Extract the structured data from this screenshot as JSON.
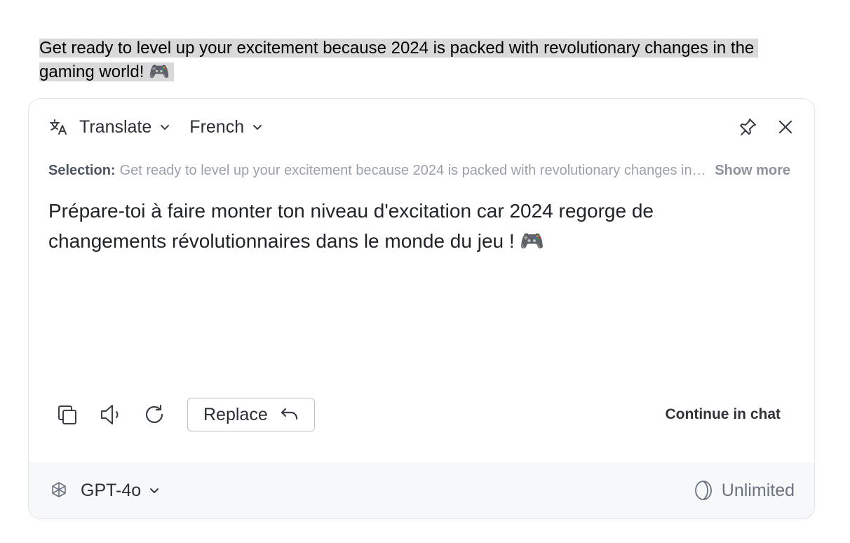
{
  "selected_text": "Get ready to level up your excitement because 2024 is packed with revolutionary changes in the gaming world! 🎮",
  "header": {
    "mode_label": "Translate",
    "language_label": "French"
  },
  "selection": {
    "label": "Selection:",
    "value": "Get ready to level up your excitement because 2024 is packed with revolutionary changes in the gaming world! 🎮",
    "show_more_label": "Show more"
  },
  "translation": "Prépare-toi à faire monter ton niveau d'excitation car 2024 regorge de changements révolutionnaires dans le monde du jeu ! 🎮",
  "actions": {
    "replace_label": "Replace",
    "continue_label": "Continue in chat"
  },
  "footer": {
    "model_label": "GPT-4o",
    "quota_label": "Unlimited"
  },
  "icons": {
    "translate": "translate-icon",
    "chevron": "chevron-down-icon",
    "pin": "pin-icon",
    "close": "close-icon",
    "copy": "copy-icon",
    "speaker": "speaker-icon",
    "regenerate": "refresh-icon",
    "undo": "undo-icon",
    "model": "openai-icon",
    "quota": "quota-icon"
  },
  "colors": {
    "highlight": "#d9d9d9",
    "footer_bg": "#f7f8fa",
    "muted_text": "#9aa1ab"
  }
}
